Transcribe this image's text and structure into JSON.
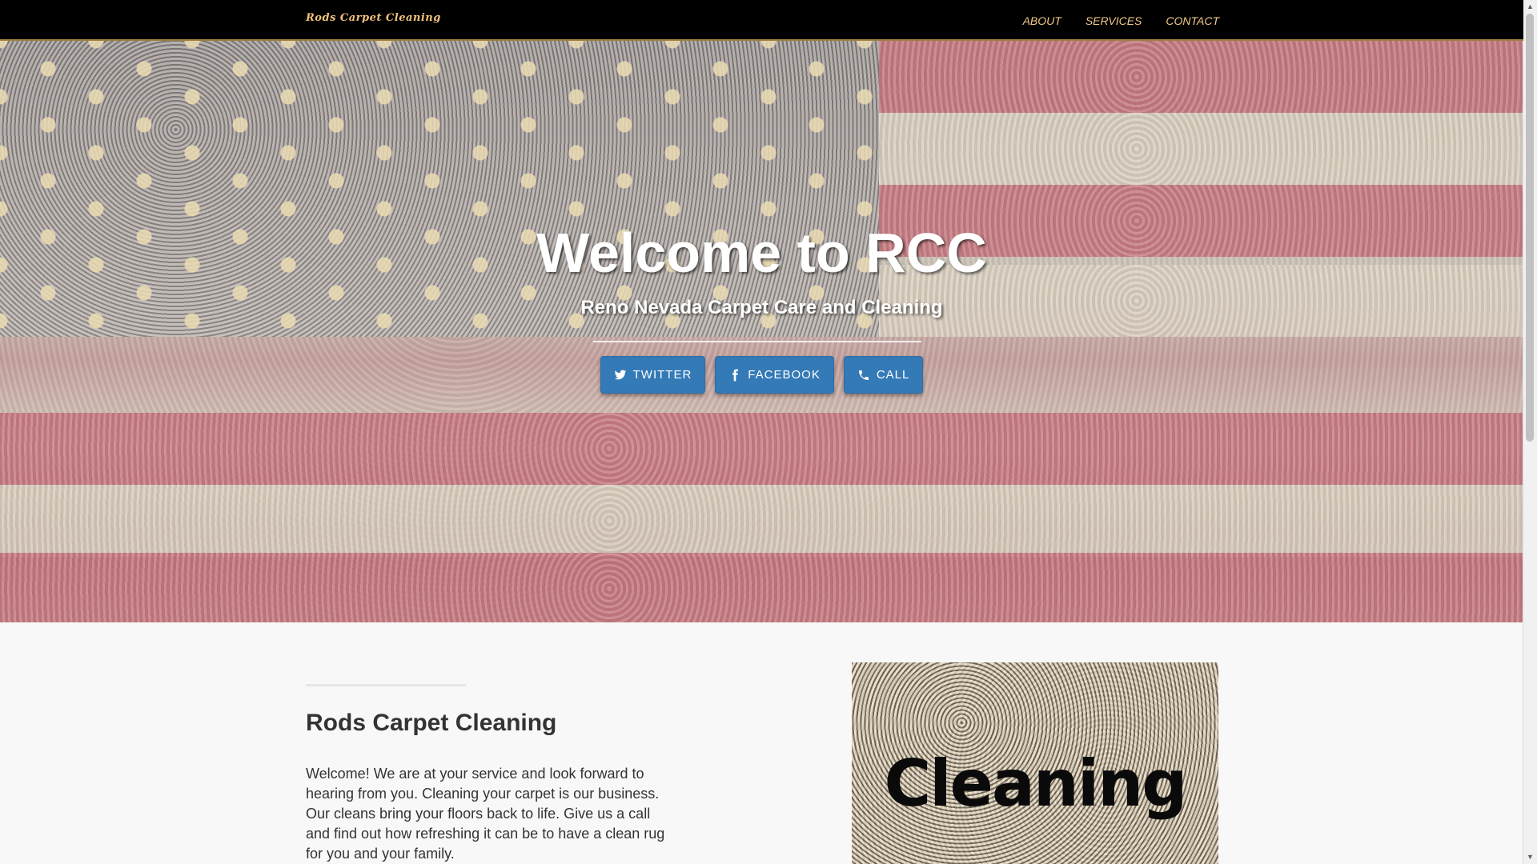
{
  "navbar": {
    "brand": "Rods Carpet Cleaning",
    "links": [
      "ABOUT",
      "SERVICES",
      "CONTACT"
    ]
  },
  "hero": {
    "title": "Welcome to RCC",
    "subtitle": "Reno Nevada Carpet Care and Cleaning",
    "buttons": [
      {
        "label": "TWITTER",
        "icon": "twitter-icon"
      },
      {
        "label": "FACEBOOK",
        "icon": "facebook-icon"
      },
      {
        "label": "CALL",
        "icon": "phone-icon"
      }
    ]
  },
  "about": {
    "title": "Rods Carpet Cleaning",
    "text": "Welcome! We are at your service and look forward to hearing from you. Cleaning your carpet is our business. Our cleans bring your floors back to life. Give us a call and find out how refreshing it can be to have a clean rug for you and your family.",
    "image_word": "Cleaning"
  },
  "colors": {
    "navbar_bg": "#000000",
    "nav_link": "#f5c98a",
    "button": "#337ab7",
    "page_bg": "#f8f8f8"
  }
}
